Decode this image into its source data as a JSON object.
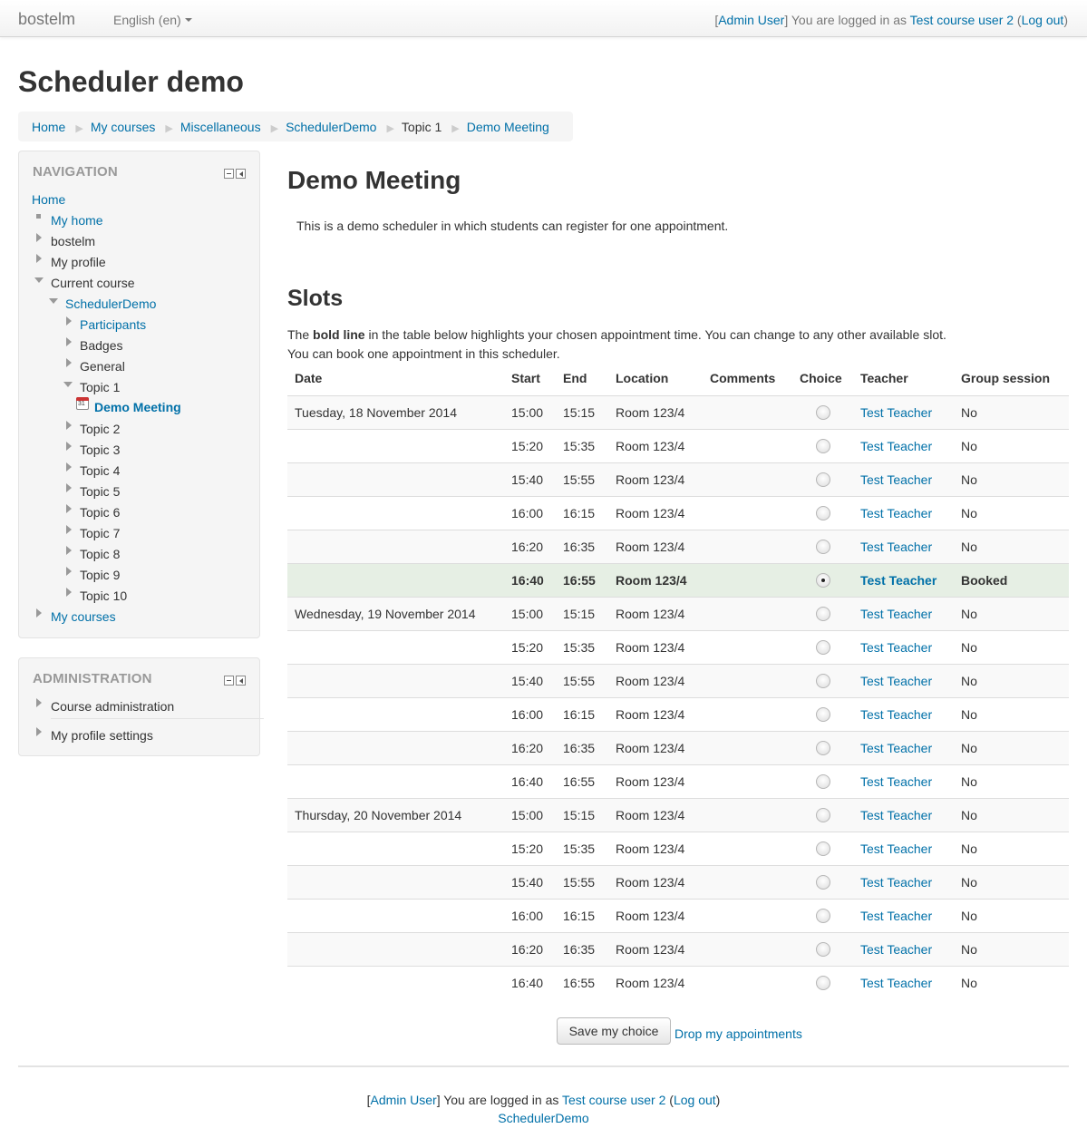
{
  "navbar": {
    "brand": "bostelm",
    "language": "English (en)",
    "login": {
      "open": "[",
      "admin": "Admin User",
      "close": "]",
      "text": " You are logged in as ",
      "user": "Test course user 2",
      "paren_open": " (",
      "logout": "Log out",
      "paren_close": ")"
    }
  },
  "page_title": "Scheduler demo",
  "breadcrumb": [
    {
      "label": "Home",
      "link": true
    },
    {
      "label": "My courses",
      "link": true
    },
    {
      "label": "Miscellaneous",
      "link": true
    },
    {
      "label": "SchedulerDemo",
      "link": true
    },
    {
      "label": "Topic 1",
      "link": false
    },
    {
      "label": "Demo Meeting",
      "link": true
    }
  ],
  "navigation": {
    "title": "NAVIGATION",
    "home": "Home",
    "my_home": "My home",
    "site": "bostelm",
    "my_profile": "My profile",
    "current_course": "Current course",
    "course": "SchedulerDemo",
    "participants": "Participants",
    "badges": "Badges",
    "general": "General",
    "topic1": "Topic 1",
    "activity": "Demo Meeting",
    "topics": [
      "Topic 2",
      "Topic 3",
      "Topic 4",
      "Topic 5",
      "Topic 6",
      "Topic 7",
      "Topic 8",
      "Topic 9",
      "Topic 10"
    ],
    "my_courses": "My courses"
  },
  "administration": {
    "title": "ADMINISTRATION",
    "course_admin": "Course administration",
    "profile_settings": "My profile settings"
  },
  "main": {
    "heading": "Demo Meeting",
    "intro": "This is a demo scheduler in which students can register for one appointment.",
    "slots_heading": "Slots",
    "help_pre": "The ",
    "help_bold": "bold line",
    "help_post": " in the table below highlights your chosen appointment time. You can change to any other available slot.",
    "help_line2": "You can book one appointment in this scheduler.",
    "columns": [
      "Date",
      "Start",
      "End",
      "Location",
      "Comments",
      "Choice",
      "Teacher",
      "Group session"
    ],
    "rows": [
      {
        "date": "Tuesday, 18 November 2014",
        "start": "15:00",
        "end": "15:15",
        "location": "Room 123/4",
        "comments": "",
        "chosen": false,
        "teacher": "Test Teacher",
        "group": "No"
      },
      {
        "date": "",
        "start": "15:20",
        "end": "15:35",
        "location": "Room 123/4",
        "comments": "",
        "chosen": false,
        "teacher": "Test Teacher",
        "group": "No"
      },
      {
        "date": "",
        "start": "15:40",
        "end": "15:55",
        "location": "Room 123/4",
        "comments": "",
        "chosen": false,
        "teacher": "Test Teacher",
        "group": "No"
      },
      {
        "date": "",
        "start": "16:00",
        "end": "16:15",
        "location": "Room 123/4",
        "comments": "",
        "chosen": false,
        "teacher": "Test Teacher",
        "group": "No"
      },
      {
        "date": "",
        "start": "16:20",
        "end": "16:35",
        "location": "Room 123/4",
        "comments": "",
        "chosen": false,
        "teacher": "Test Teacher",
        "group": "No"
      },
      {
        "date": "",
        "start": "16:40",
        "end": "16:55",
        "location": "Room 123/4",
        "comments": "",
        "chosen": true,
        "teacher": "Test Teacher",
        "group": "Booked"
      },
      {
        "date": "Wednesday, 19 November 2014",
        "start": "15:00",
        "end": "15:15",
        "location": "Room 123/4",
        "comments": "",
        "chosen": false,
        "teacher": "Test Teacher",
        "group": "No"
      },
      {
        "date": "",
        "start": "15:20",
        "end": "15:35",
        "location": "Room 123/4",
        "comments": "",
        "chosen": false,
        "teacher": "Test Teacher",
        "group": "No"
      },
      {
        "date": "",
        "start": "15:40",
        "end": "15:55",
        "location": "Room 123/4",
        "comments": "",
        "chosen": false,
        "teacher": "Test Teacher",
        "group": "No"
      },
      {
        "date": "",
        "start": "16:00",
        "end": "16:15",
        "location": "Room 123/4",
        "comments": "",
        "chosen": false,
        "teacher": "Test Teacher",
        "group": "No"
      },
      {
        "date": "",
        "start": "16:20",
        "end": "16:35",
        "location": "Room 123/4",
        "comments": "",
        "chosen": false,
        "teacher": "Test Teacher",
        "group": "No"
      },
      {
        "date": "",
        "start": "16:40",
        "end": "16:55",
        "location": "Room 123/4",
        "comments": "",
        "chosen": false,
        "teacher": "Test Teacher",
        "group": "No"
      },
      {
        "date": "Thursday, 20 November 2014",
        "start": "15:00",
        "end": "15:15",
        "location": "Room 123/4",
        "comments": "",
        "chosen": false,
        "teacher": "Test Teacher",
        "group": "No"
      },
      {
        "date": "",
        "start": "15:20",
        "end": "15:35",
        "location": "Room 123/4",
        "comments": "",
        "chosen": false,
        "teacher": "Test Teacher",
        "group": "No"
      },
      {
        "date": "",
        "start": "15:40",
        "end": "15:55",
        "location": "Room 123/4",
        "comments": "",
        "chosen": false,
        "teacher": "Test Teacher",
        "group": "No"
      },
      {
        "date": "",
        "start": "16:00",
        "end": "16:15",
        "location": "Room 123/4",
        "comments": "",
        "chosen": false,
        "teacher": "Test Teacher",
        "group": "No"
      },
      {
        "date": "",
        "start": "16:20",
        "end": "16:35",
        "location": "Room 123/4",
        "comments": "",
        "chosen": false,
        "teacher": "Test Teacher",
        "group": "No"
      },
      {
        "date": "",
        "start": "16:40",
        "end": "16:55",
        "location": "Room 123/4",
        "comments": "",
        "chosen": false,
        "teacher": "Test Teacher",
        "group": "No"
      }
    ],
    "save_button": "Save my choice",
    "drop_link": "Drop my appointments"
  },
  "footer": {
    "course_link": "SchedulerDemo"
  },
  "colors": {
    "link": "#0070a8",
    "booked_row": "#e6efe4",
    "block_bg": "#f5f5f5"
  }
}
